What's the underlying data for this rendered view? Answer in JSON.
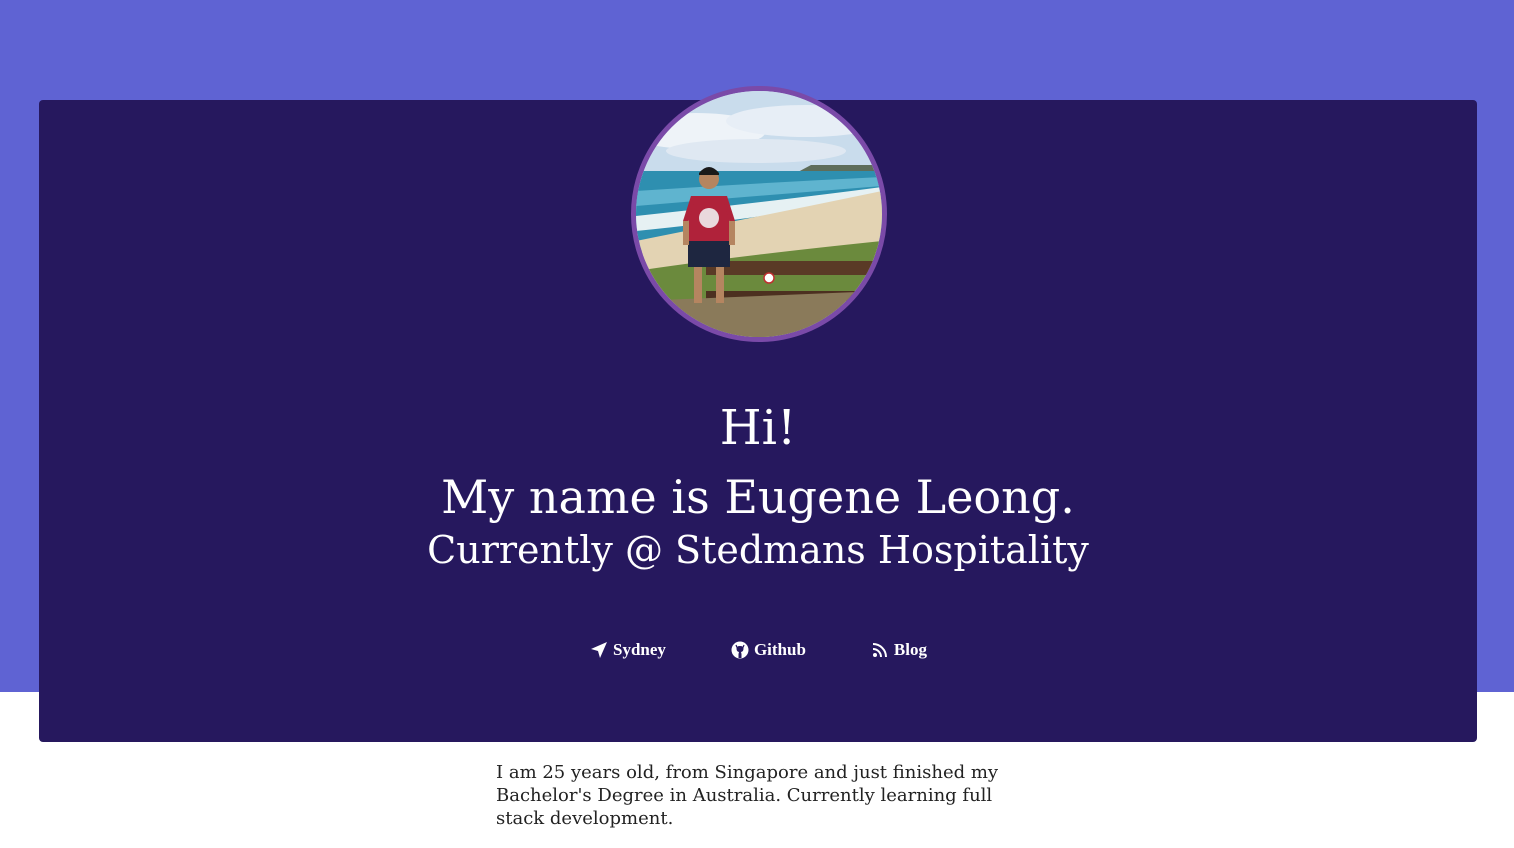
{
  "hero": {
    "greeting": "Hi!",
    "name_line": "My name is Eugene Leong.",
    "current_line": "Currently @ Stedmans Hospitality"
  },
  "links": [
    {
      "label": "Sydney",
      "icon": "location-arrow-icon"
    },
    {
      "label": "Github",
      "icon": "github-icon"
    },
    {
      "label": "Blog",
      "icon": "rss-icon"
    }
  ],
  "about": {
    "text": "I am 25 years old, from Singapore and just finished my Bachelor's Degree in Australia. Currently learning full stack development."
  },
  "colors": {
    "top_band": "#5f63d3",
    "card": "#26185e",
    "avatar_ring": "#7a4aa8",
    "text_light": "#ffffff"
  }
}
